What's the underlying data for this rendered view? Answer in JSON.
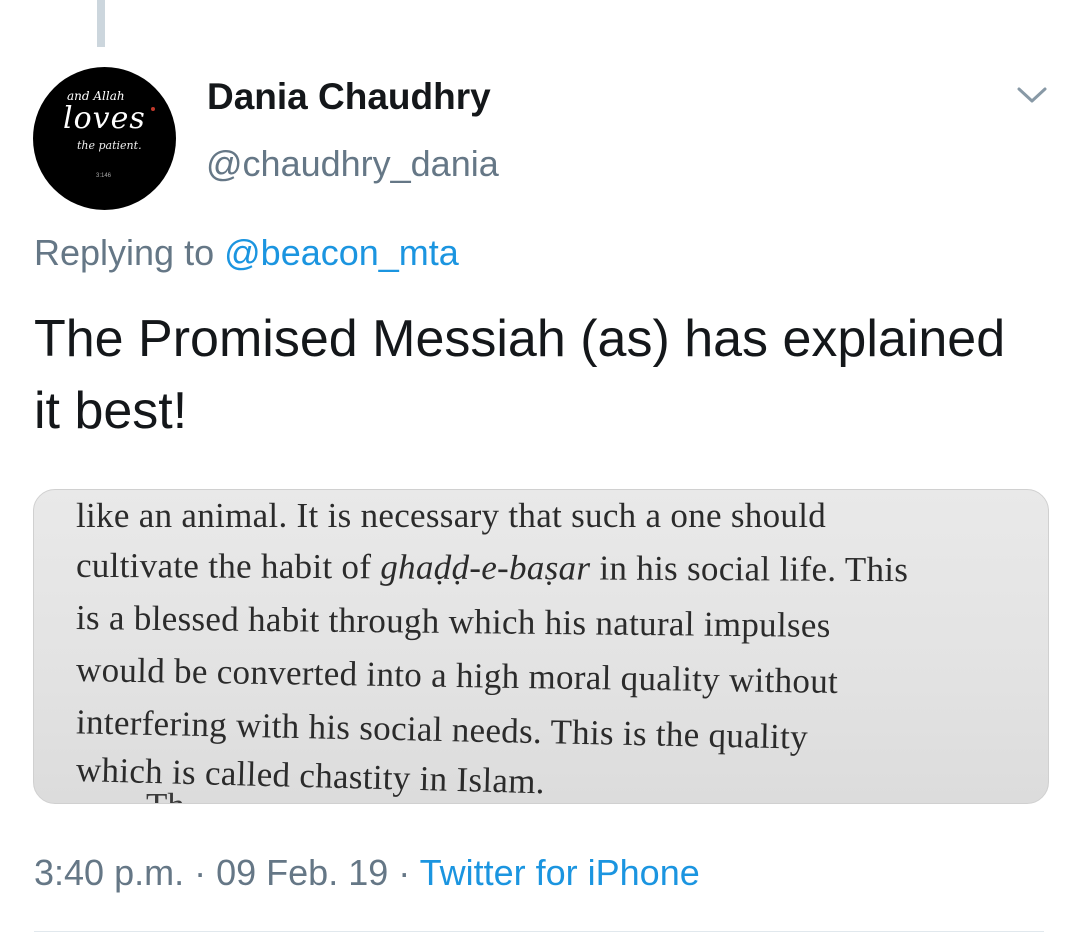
{
  "author": {
    "display_name": "Dania Chaudhry",
    "handle": "@chaudhry_dania",
    "avatar_text": {
      "line1": "and Allah",
      "line2": "loves",
      "line3": "the patient.",
      "line4": "3:146"
    }
  },
  "menu": {
    "icon": "chevron-down-icon"
  },
  "reply": {
    "prefix": "Replying to",
    "mention": "@beacon_mta"
  },
  "tweet": {
    "text": "The Promised Messiah (as) has explained it best!"
  },
  "media": {
    "lines": [
      "like an animal. It is necessary that such a one should",
      "cultivate the habit of",
      "is a blessed habit through which his natural impulses",
      "would be converted into a high moral quality without",
      "interfering with his social needs. This is the quality",
      "which is called chastity in Islam."
    ],
    "italic_term": "ghaḍḍ-e-baṣar",
    "line2_suffix": "in his social life. This",
    "cutoff_text": "Th"
  },
  "meta": {
    "time": "3:40 p.m.",
    "separator": "·",
    "date": "09 Feb. 19",
    "source": "Twitter for iPhone"
  },
  "colors": {
    "link": "#1b95e0",
    "secondary_text": "#657786",
    "primary_text": "#14171a",
    "thread_line": "#ccd6dd"
  }
}
